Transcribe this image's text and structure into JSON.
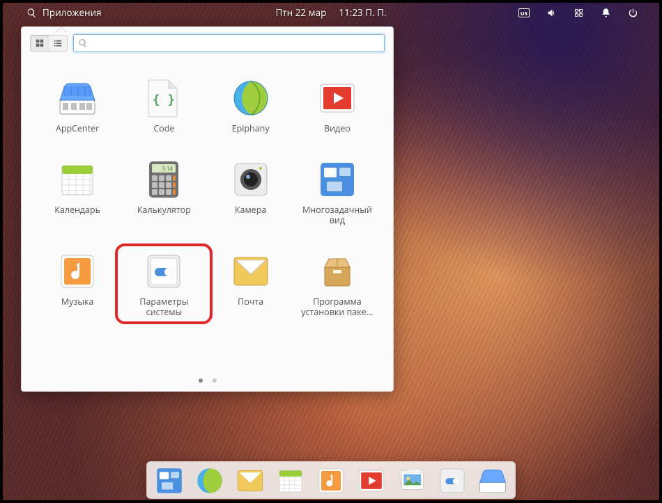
{
  "panel": {
    "applications_label": "Приложения",
    "date": "Птн 22 мар",
    "time": "11:23 П. П.",
    "kb_layout": "us"
  },
  "popover": {
    "search_placeholder": "",
    "pager": {
      "count": 2,
      "active": 0
    }
  },
  "apps": [
    {
      "id": "appcenter",
      "label": "AppCenter"
    },
    {
      "id": "code",
      "label": "Code"
    },
    {
      "id": "epiphany",
      "label": "Epiphany"
    },
    {
      "id": "videos",
      "label": "Видео"
    },
    {
      "id": "calendar",
      "label": "Календарь"
    },
    {
      "id": "calculator",
      "label": "Калькулятор"
    },
    {
      "id": "camera",
      "label": "Камера"
    },
    {
      "id": "multitask",
      "label": "Многозадачный\nвид"
    },
    {
      "id": "music",
      "label": "Музыка"
    },
    {
      "id": "settings",
      "label": "Параметры\nсистемы",
      "highlighted": true
    },
    {
      "id": "mail",
      "label": "Почта"
    },
    {
      "id": "installer",
      "label": "Программа\nустановки паке..."
    }
  ],
  "dock": [
    "multitask",
    "epiphany",
    "mail",
    "calendar",
    "music",
    "videos",
    "photos",
    "settings",
    "appcenter"
  ]
}
